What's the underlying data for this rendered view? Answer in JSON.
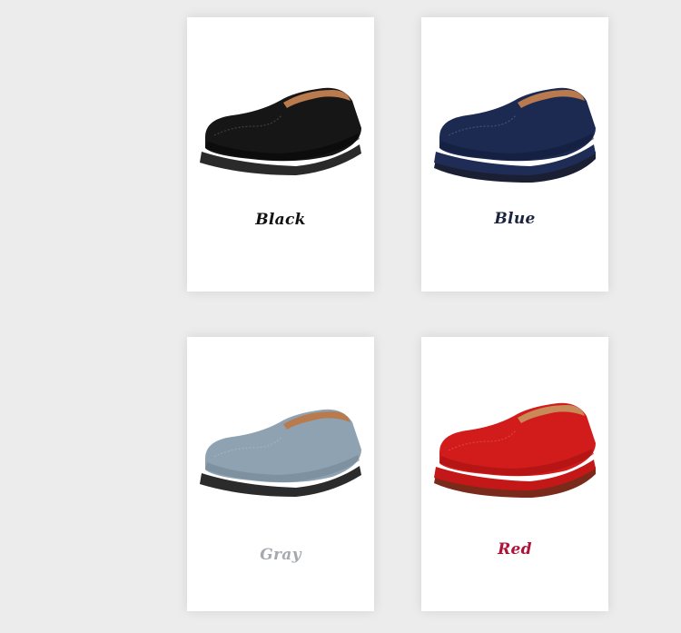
{
  "products": [
    {
      "id": "black",
      "label": "Black",
      "label_color": "#111111",
      "upper": "#161616",
      "upper_shade": "#050505",
      "sole": "#2a2a2a",
      "base": "#ffffff",
      "lining": "#b97a4e"
    },
    {
      "id": "blue",
      "label": "Blue",
      "label_color": "#1a2340",
      "upper": "#1c2a52",
      "upper_shade": "#101a36",
      "sole": "#1f2c55",
      "base": "#1a1f33",
      "lining": "#b97a4e"
    },
    {
      "id": "gray",
      "label": "Gray",
      "label_color": "#a5a8ad",
      "upper": "#8ea2b2",
      "upper_shade": "#6f8394",
      "sole": "#2b2b2b",
      "base": "#ffffff",
      "lining": "#b97a4e"
    },
    {
      "id": "red",
      "label": "Red",
      "label_color": "#b0123a",
      "upper": "#d21c1c",
      "upper_shade": "#9e1010",
      "sole": "#c41717",
      "base": "#7a2a1a",
      "lining": "#c98a5a"
    }
  ]
}
